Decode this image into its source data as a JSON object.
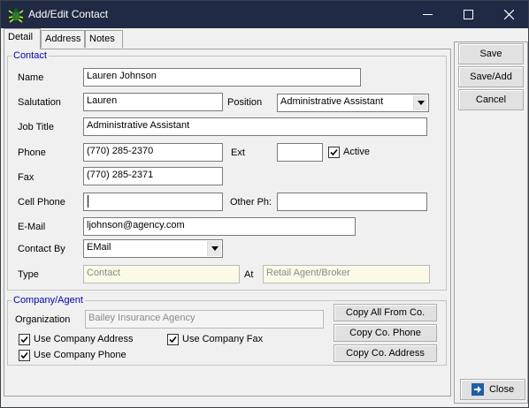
{
  "window": {
    "title": "Add/Edit Contact"
  },
  "tabs": [
    {
      "label": "Detail"
    },
    {
      "label": "Address"
    },
    {
      "label": "Notes"
    }
  ],
  "contact": {
    "group_title": "Contact",
    "name_label": "Name",
    "name_value": "Lauren Johnson",
    "salutation_label": "Salutation",
    "salutation_value": "Lauren",
    "position_label": "Position",
    "position_value": "Administrative Assistant",
    "job_title_label": "Job Title",
    "job_title_value": "Administrative Assistant",
    "phone_label": "Phone",
    "phone_value": "(770) 285-2370",
    "ext_label": "Ext",
    "ext_value": "",
    "active_label": "Active",
    "active_checked": true,
    "fax_label": "Fax",
    "fax_value": "(770) 285-2371",
    "cell_label": "Cell Phone",
    "cell_value": "",
    "other_label": "Other Ph:",
    "other_value": "",
    "email_label": "E-Mail",
    "email_value": "ljohnson@agency.com",
    "contact_by_label": "Contact By",
    "contact_by_value": "EMail",
    "type_label": "Type",
    "type_value": "Contact",
    "at_label": "At",
    "at_value": "Retail Agent/Broker"
  },
  "company": {
    "group_title": "Company/Agent",
    "org_label": "Organization",
    "org_value": "Bailey Insurance Agency",
    "use_address_label": "Use Company Address",
    "use_fax_label": "Use Company Fax",
    "use_phone_label": "Use Company Phone",
    "copy_all_label": "Copy All From Co.",
    "copy_phone_label": "Copy Co. Phone",
    "copy_address_label": "Copy Co. Address"
  },
  "actions": {
    "save_label": "Save",
    "save_add_label": "Save/Add",
    "cancel_label": "Cancel",
    "close_label": "Close"
  },
  "colors": {
    "titlebar": "#202a44",
    "group_title": "#0000c0",
    "readonly_bg": "#fafae6"
  },
  "icons": {
    "app": "bug-app-icon",
    "minimize": "minimize-icon",
    "maximize": "maximize-icon",
    "close": "close-icon",
    "close_button": "exit-arrow-icon",
    "dropdown": "chevron-down-icon",
    "checkbox": "checkmark-icon"
  }
}
